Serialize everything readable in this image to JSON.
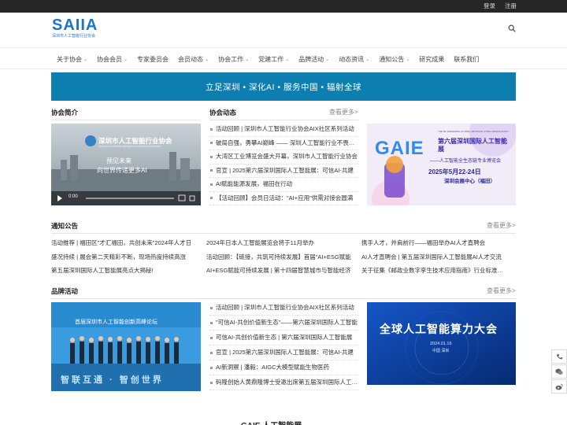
{
  "topbar": {
    "login": "登录",
    "register": "注册"
  },
  "logo": {
    "text": "SAIIA",
    "subtitle": "深圳市人工智能行业协会"
  },
  "nav": [
    {
      "label": "关于协会",
      "chevron": true
    },
    {
      "label": "协会会员",
      "chevron": true
    },
    {
      "label": "专家委员会",
      "chevron": false
    },
    {
      "label": "会员动态",
      "chevron": true
    },
    {
      "label": "协会工作",
      "chevron": true
    },
    {
      "label": "党建工作",
      "chevron": true
    },
    {
      "label": "品牌活动",
      "chevron": true
    },
    {
      "label": "动态资讯",
      "chevron": true
    },
    {
      "label": "通知公告",
      "chevron": true
    },
    {
      "label": "研究成果",
      "chevron": false
    },
    {
      "label": "联系我们",
      "chevron": false
    }
  ],
  "banner": {
    "text": "立足深圳 • 深化AI • 服务中国 • 辐射全球"
  },
  "intro": {
    "title": "协会简介",
    "video": {
      "org_name": "深圳市人工智能行业协会",
      "org_name_en": "Shenzhen Artificial Intelligence Industry Association",
      "line1": "预见未来",
      "line2": "向世界传递更多AI",
      "time": "0:00"
    }
  },
  "dynamics": {
    "title": "协会动态",
    "more": "查看更多>",
    "items": [
      "活动回顾 | 深圳市人工智能行业协会AIX社区系列活动",
      "破局自强，勇攀AI巅峰 —— 深圳人工智能行业不畏艰难",
      "大湾区工业博览会盛大开幕，深圳市人工智能行业协会",
      "官宣 | 2025第六届深圳国际人工智能展：可信AI-共建",
      "AI赋能能源发展，福田在行动",
      "【活动回顾】会员日活动：\"AI+应用\"供需对接会圆满"
    ]
  },
  "expo": {
    "brand": "GAIE",
    "title_cn": "第六届深圳国际人工智能展",
    "title_en": "THE 6th SHENZHEN GLOBAL ARTIFICIAL INTELLIGENCE EXPO",
    "subtitle": "——人工智能全生态链专业博览会",
    "date": "2025年5月22-24日",
    "venue": "深圳会展中心（福田）"
  },
  "notice": {
    "title": "通知公告",
    "more": "查看更多>",
    "items": [
      "活动推荐 | 福田区\"才汇福田，共创未来\"2024年人才日",
      "2024年日本人工智能展览会将于11月举办",
      "携手人才，并肩前行——福田举办AI人才直聘会",
      "盛况持续 | 展会第二天精彩不断，现场热度持续高涨",
      "活动回顾：【链接，共筑可持续发展】首届\"AI+ESG赋能",
      "AI人才直聘会 | 第五届深圳国际人工智能展AI人才交流",
      "第五届深圳国际人工智能展亮点大揭秘!",
      "AI+ESG赋能可持续发展 | 第十四届智慧城市与智能经济",
      "关于征集《邮政业数字孪生技术应用指南》行业标准起草"
    ]
  },
  "brand": {
    "title": "品牌活动",
    "more": "查看更多>",
    "photo_banner": "首届深圳市人工智能创新高峰论坛",
    "photo_slogan": "智联互通 · 智创世界",
    "items": [
      "活动回顾 | 深圳市人工智能行业协会AIX社区系列活动",
      "\"可信AI-共创价值新生态\"——第六届深圳国际人工智能",
      "可信AI-共创价值新生态 | 第六届深圳国际人工智能展",
      "官宣 | 2025第六届深圳国际人工智能展：可信AI-共建",
      "AI新洞察 | 潘毅：AIGC大模型赋能生物医药",
      "码隆创始人黄鼎隆博士受邀出席第五届深圳国际人工智能"
    ],
    "poster": {
      "title": "全球人工智能算力大会",
      "date": "2024.01.16",
      "venue": "中国 深圳"
    }
  },
  "bottom_heading": "GAIE 人工智能展",
  "colors": {
    "brand_blue": "#1f74c2",
    "banner": "#0d7eb0",
    "topbar": "#262626"
  }
}
